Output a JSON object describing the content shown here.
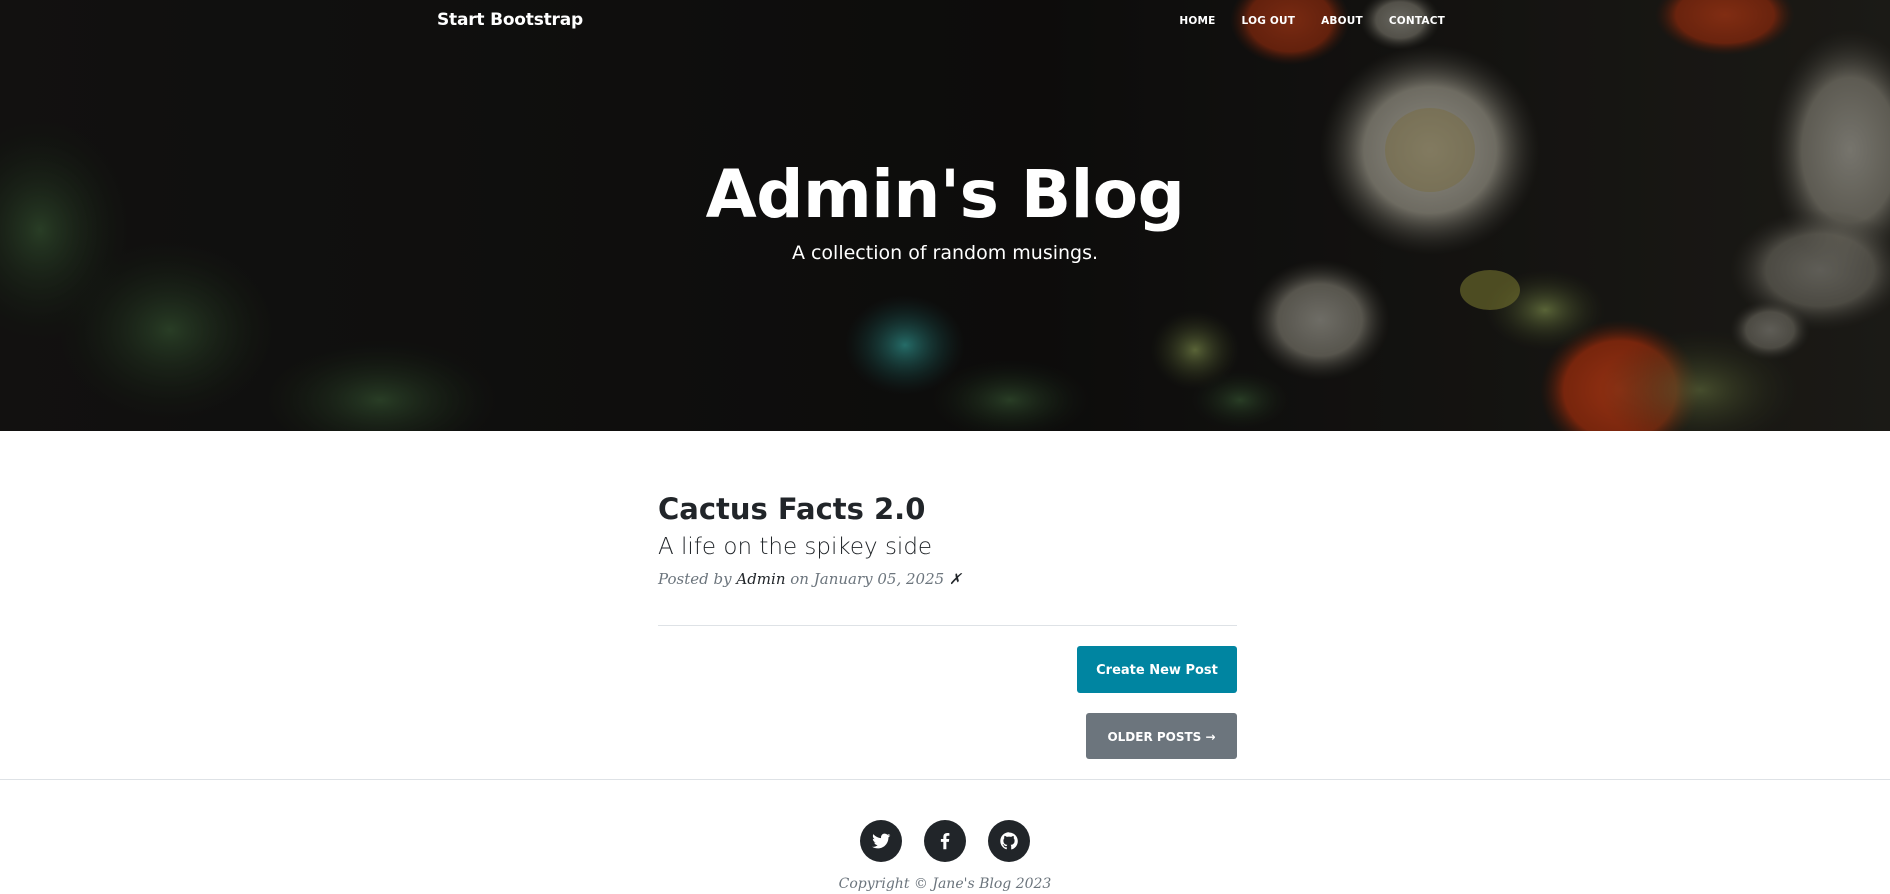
{
  "navbar": {
    "brand": "Start Bootstrap",
    "links": [
      "Home",
      "Log Out",
      "About",
      "Contact"
    ]
  },
  "header": {
    "title": "Admin's Blog",
    "subtitle": "A collection of random musings."
  },
  "post": {
    "title": "Cactus Facts 2.0",
    "subtitle": "A life on the spikey side",
    "meta_prefix": "Posted by",
    "author": "Admin",
    "date_prefix": "on",
    "date": "January 05, 2025",
    "delete_symbol": "✗"
  },
  "actions": {
    "create_label": "Create New Post",
    "older_label": "Older Posts →"
  },
  "footer": {
    "social": [
      "twitter-icon",
      "facebook-icon",
      "github-icon"
    ],
    "copyright": "Copyright © Jane's Blog 2023"
  },
  "colors": {
    "primary_button": "#0085a1",
    "secondary_button": "#6c757d",
    "social_icon_bg": "#212529"
  }
}
